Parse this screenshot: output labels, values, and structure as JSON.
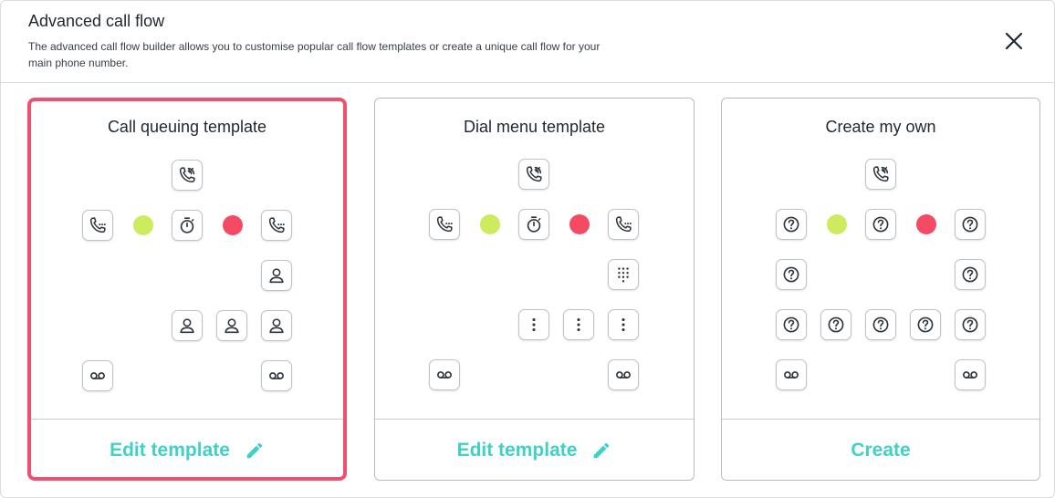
{
  "header": {
    "title": "Advanced call flow",
    "description": "The advanced call flow builder allows you to customise popular call flow templates or create a unique call flow for your main phone number."
  },
  "colors": {
    "accent": "#40d0c8",
    "selected_border": "#f0506e",
    "green_dot": "#cdeb5e",
    "red_dot": "#f54a64"
  },
  "cards": [
    {
      "title": "Call queuing template",
      "action_label": "Edit template",
      "action_icon": "pencil-icon",
      "selected": true
    },
    {
      "title": "Dial menu template",
      "action_label": "Edit template",
      "action_icon": "pencil-icon",
      "selected": false
    },
    {
      "title": "Create my own",
      "action_label": "Create",
      "action_icon": "",
      "selected": false
    }
  ]
}
